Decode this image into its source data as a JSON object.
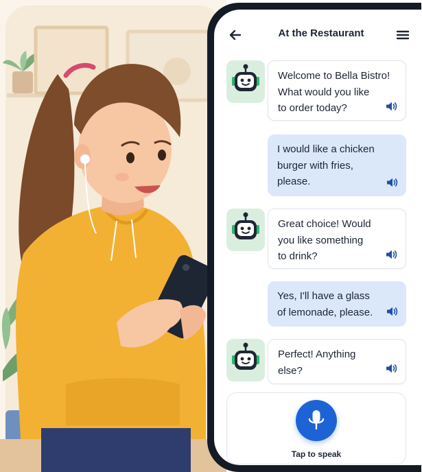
{
  "header": {
    "title": "At the Restaurant",
    "back_icon": "arrow-left-icon",
    "menu_icon": "hamburger-menu-icon"
  },
  "messages": [
    {
      "sender": "bot",
      "text": "Welcome to Bella Bistro!\nWhat would you like\nto order today?"
    },
    {
      "sender": "user",
      "text": "I would like a chicken\nburger with fries,\nplease."
    },
    {
      "sender": "bot",
      "text": "Great choice! Would\nyou like something\nto drink?"
    },
    {
      "sender": "user",
      "text": "Yes, I'll have a glass\nof lemonade, please."
    },
    {
      "sender": "bot",
      "text": "Perfect! Anything\nelse?"
    }
  ],
  "speak": {
    "label": "Tap to speak",
    "icon": "microphone-icon"
  },
  "colors": {
    "accent": "#1e63d6",
    "user_bubble": "#dbe8fa",
    "avatar_bg": "#d9eedf",
    "phone_frame": "#151b24"
  }
}
